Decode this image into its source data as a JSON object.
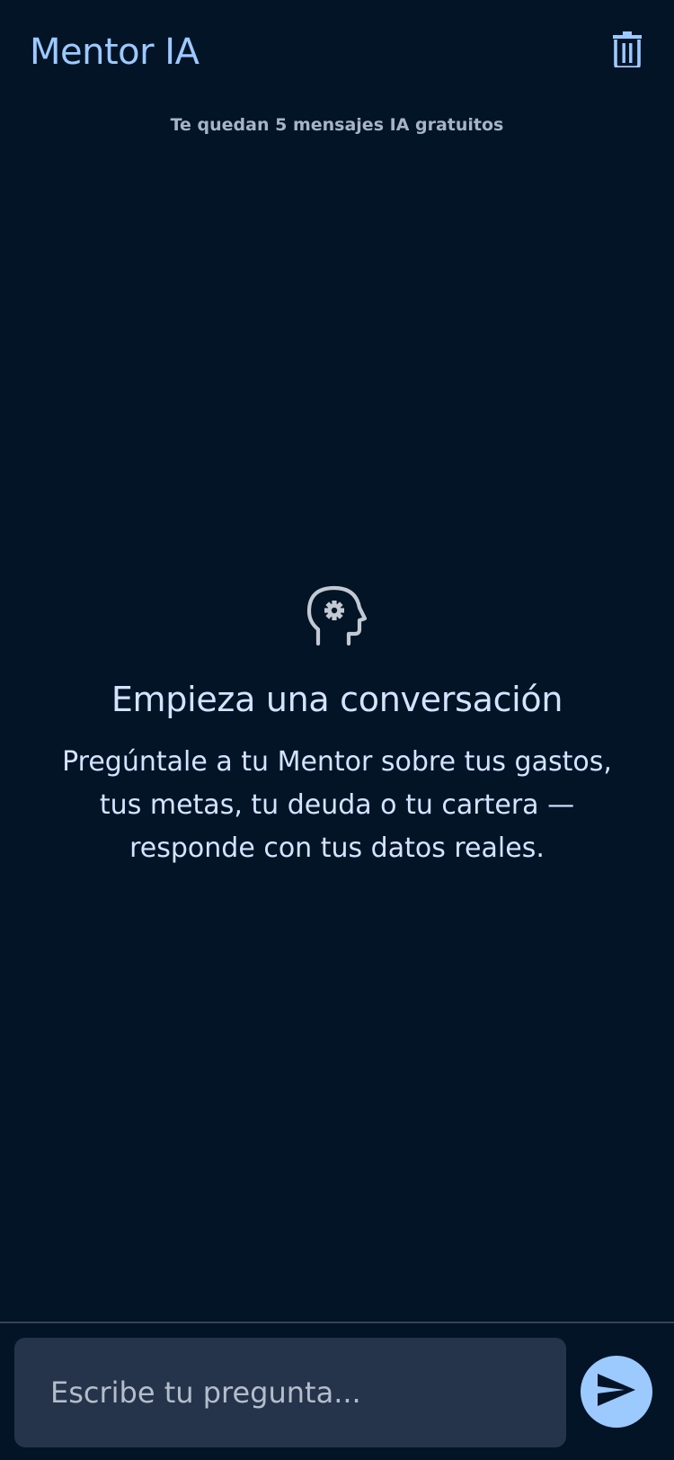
{
  "header": {
    "title": "Mentor IA",
    "trash_icon": "trash-icon"
  },
  "quota": {
    "text": "Te quedan 5 mensajes IA gratuitos"
  },
  "empty_state": {
    "icon": "head-gear-icon",
    "title": "Empieza una conversación",
    "description": "Pregúntale a tu Mentor sobre tus gastos, tus metas, tu deuda o tu cartera — responde con tus datos reales."
  },
  "composer": {
    "placeholder": "Escribe tu pregunta...",
    "value": "",
    "send_icon": "send-icon"
  },
  "colors": {
    "background": "#031427",
    "accent": "#9ccaff",
    "input_bg": "#25344a",
    "text": "#d6e3ff",
    "muted": "#a7b3c6"
  }
}
